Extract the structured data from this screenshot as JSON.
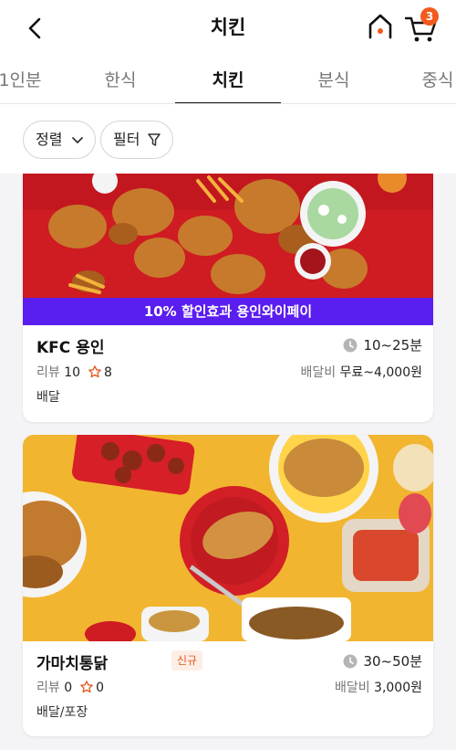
{
  "header": {
    "title": "치킨",
    "cart_count": "3"
  },
  "tabs": [
    {
      "label": "1인분"
    },
    {
      "label": "한식"
    },
    {
      "label": "치킨"
    },
    {
      "label": "분식"
    },
    {
      "label": "중식"
    }
  ],
  "filters": {
    "sort_label": "정렬",
    "filter_label": "필터"
  },
  "restaurants": [
    {
      "name": "KFC 용인",
      "promo": "10% 할인효과 용인와이페이",
      "delivery_time": "10~25분",
      "review_label": "리뷰",
      "review_count": "10",
      "favorite_count": "8",
      "fee_label": "배달비",
      "fee_value": "무료~4,000원",
      "service_type": "배달"
    },
    {
      "name": "가마치통닭",
      "badge": "신규",
      "delivery_time": "30~50분",
      "review_label": "리뷰",
      "review_count": "0",
      "favorite_count": "0",
      "fee_label": "배달비",
      "fee_value": "3,000원",
      "service_type": "배달/포장"
    }
  ],
  "colors": {
    "accent": "#f35a1e",
    "promo_banner": "#5b1ef0",
    "new_badge_text": "#e2591d"
  }
}
